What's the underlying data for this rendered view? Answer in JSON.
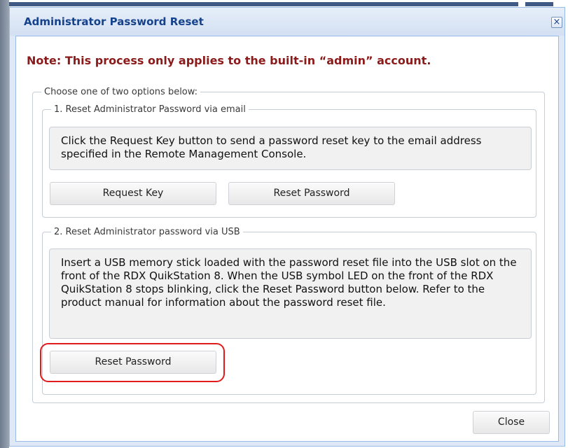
{
  "dialog": {
    "title": "Administrator Password Reset",
    "close_icon": "×",
    "note": "Note: This process only applies to the built-in “admin” account.",
    "options_legend": "Choose one of two options below:",
    "email_section": {
      "legend": "1. Reset Administrator Password via email",
      "description": "Click the Request Key button to send a password reset key to the email address specified in the Remote Management Console.",
      "request_key_label": "Request Key",
      "reset_password_label": "Reset Password"
    },
    "usb_section": {
      "legend": "2. Reset Administrator password via USB",
      "description": "Insert a USB memory stick loaded with the password reset file into the USB slot on the front of the RDX QuikStation 8. When the USB symbol LED on the front of the RDX QuikStation 8 stops blinking, click the Reset Password button below. Refer to the product manual for information about the password reset file.",
      "reset_password_label": "Reset Password"
    },
    "close_label": "Close"
  },
  "colors": {
    "title": "#15428b",
    "note": "#8b1a1a",
    "highlight": "#e11b1b",
    "dialog_bg": "#dfe8f6"
  }
}
